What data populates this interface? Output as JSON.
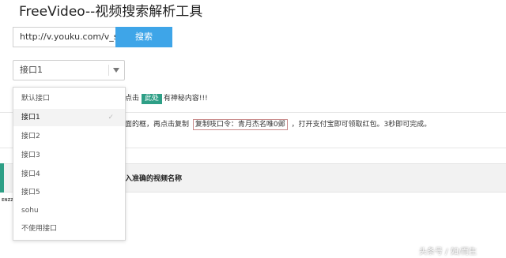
{
  "header": {
    "title": "FreeVideo--视频搜索解析工具"
  },
  "search": {
    "url_value": "http://v.youku.com/v_show/i",
    "button_label": "搜索"
  },
  "interface_select": {
    "selected": "接口1",
    "options": [
      "默认接口",
      "接口1",
      "接口2",
      "接口3",
      "接口4",
      "接口5",
      "sohu",
      "不使用接口"
    ],
    "selected_index": 1
  },
  "notices": {
    "line1_prefix": "点击",
    "line1_badge": "此处",
    "line1_suffix": "有神秘内容!!!",
    "line2_prefix": "面的框，再点击复制",
    "line2_code": "复制吱口令：青月杰名唯0邺",
    "line2_suffix": "，打开支付宝即可领取红包。3秒即可完成。"
  },
  "prompt_bar": {
    "text": "入准确的视频名称"
  },
  "side_label": "ENZZ",
  "watermark": {
    "text": "头条号 / 如/而生"
  },
  "colors": {
    "accent_blue": "#3ea5e8",
    "accent_green": "#2e9f86"
  },
  "icons": {
    "select_arrow": "triangle-down-icon",
    "check": "check-icon"
  }
}
